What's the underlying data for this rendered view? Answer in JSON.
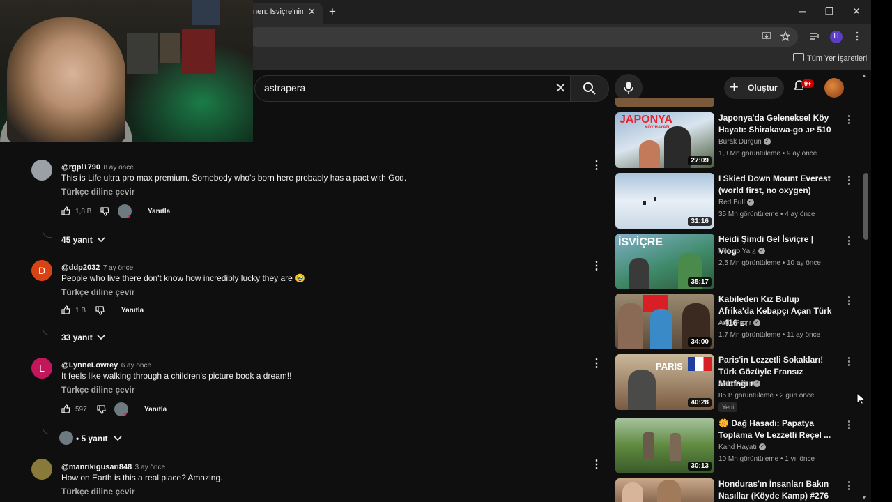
{
  "browser": {
    "tab_title": "nen: İsviçre'nin",
    "tab_close": "✕",
    "new_tab": "+",
    "window_min": "─",
    "window_max": "❐",
    "window_close": "✕",
    "profile_initial": "H",
    "bookmarks_label": "Tüm Yer İşaretleri"
  },
  "header": {
    "search_query": "astrapera",
    "create_label": "Oluştur",
    "notification_badge": "9+"
  },
  "comments": [
    {
      "handle": "@rgpl1790",
      "time": "8 ay önce",
      "text": "This is Life ultra pro max premium. Somebody who's born here probably has a pact with God.",
      "translate": "Türkçe diline çevir",
      "likes": "1,8 B",
      "reply_label": "Yanıtla",
      "replies": "45 yanıt",
      "avatar_color": "#9aa0a6",
      "avatar_letter": ""
    },
    {
      "handle": "@ddp2032",
      "time": "7 ay önce",
      "text": "People who live there don't know how incredibly lucky they are 🥹",
      "translate": "Türkçe diline çevir",
      "likes": "1 B",
      "reply_label": "Yanıtla",
      "replies": "33 yanıt",
      "avatar_color": "#d84315",
      "avatar_letter": "D"
    },
    {
      "handle": "@LynneLowrey",
      "time": "6 ay önce",
      "text": "It feels like walking through a children's picture book a dream!!",
      "translate": "Türkçe diline çevir",
      "likes": "597",
      "reply_label": "Yanıtla",
      "replies": "• 5 yanıt",
      "avatar_color": "#c2185b",
      "avatar_letter": "L"
    },
    {
      "handle": "@manrikigusari848",
      "time": "3 ay önce",
      "text": "How on Earth is this a real place? Amazing.",
      "translate": "Türkçe diline çevir",
      "avatar_color": "#8a7a3a",
      "avatar_letter": ""
    }
  ],
  "sidebar": {
    "videos": [
      {
        "title": "Japonya'da Geleneksel Köy Hayatı: Shirakawa-go ᴊᴘ 510",
        "channel": "Burak Durgun",
        "meta": "1,3 Mn görüntüleme • 9 ay önce",
        "duration": "27:09",
        "thumb_text": "JAPONYA",
        "thumb_sub": "KÖY HAYATI",
        "thumb_color": "#6d8fb5"
      },
      {
        "title": "I Skied Down Mount Everest (world first, no oxygen)",
        "channel": "Red Bull",
        "meta": "35 Mn görüntüleme • 4 ay önce",
        "duration": "31:16",
        "thumb_color": "#b8cde0"
      },
      {
        "title": "Heidi Şimdi Gel İsviçre | Vlog",
        "channel": "Noluyo Ya ¿",
        "meta": "2,5 Mn görüntüleme • 10 ay önce",
        "duration": "35:17",
        "thumb_text": "İSVİÇRE",
        "thumb_color": "#3f8a6a"
      },
      {
        "title": "Kabileden Kız Bulup Afrika'da Kebapçı Açan Türk - 416 ᴇᴛ",
        "channel": "Arda Pazır",
        "meta": "1,7 Mn görüntüleme • 11 ay önce",
        "duration": "34:00",
        "thumb_color": "#7a6a55"
      },
      {
        "title": "Paris'in Lezzetli Sokakları! Türk Gözüyle Fransız Mutfağı ғʀ",
        "channel": "Arda Pazır",
        "meta": "85 B görüntüleme • 2 gün önce",
        "duration": "40:28",
        "badge": "Yeni",
        "thumb_text": "PARIS",
        "thumb_color": "#8a7060"
      },
      {
        "title": "🌼 Dağ Hasadı: Papatya Toplama Ve Lezzetli Reçel ...",
        "channel": "Kand Hayatı",
        "meta": "10 Mn görüntüleme • 1 yıl önce",
        "duration": "30:13",
        "thumb_color": "#5f8a3f"
      },
      {
        "title": "Honduras'ın İnsanları Bakın Nasıllar (Köyde Kamp) #276",
        "thumb_color": "#8a6a50"
      }
    ]
  },
  "icons": {
    "kebab": "⋮",
    "chevron": "⌄",
    "clear": "✕"
  }
}
